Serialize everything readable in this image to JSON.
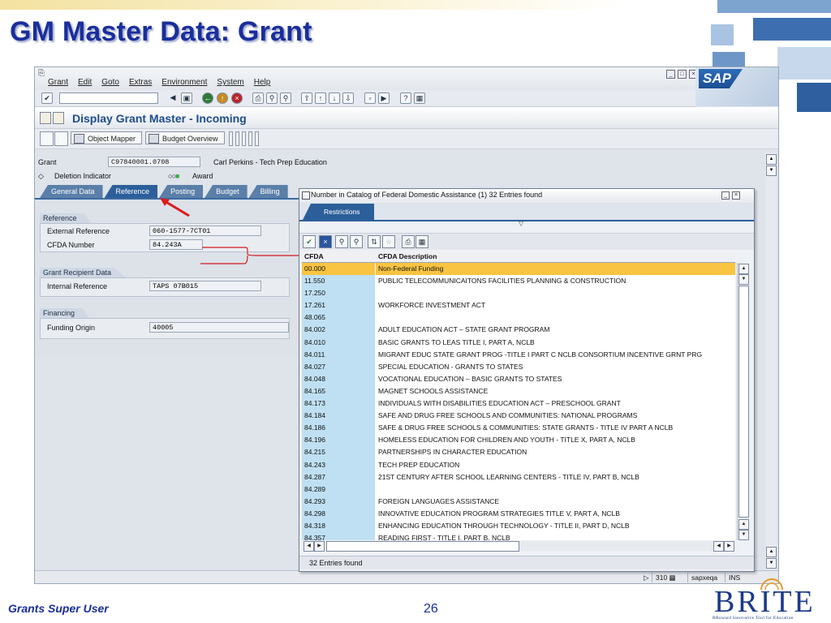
{
  "slide": {
    "title": "GM Master Data: Grant",
    "footer_left": "Grants Super User",
    "page_number": "26",
    "logo_word": "BRITE",
    "logo_tagline": "BRoward Innovative Tool for Education"
  },
  "sap": {
    "menu": [
      "Grant",
      "Edit",
      "Goto",
      "Extras",
      "Environment",
      "System",
      "Help"
    ],
    "logo_text": "SAP",
    "screen_title": "Display Grant Master - Incoming",
    "app_toolbar": {
      "object_mapper": "Object Mapper",
      "budget_overview": "Budget Overview"
    },
    "header": {
      "grant_label": "Grant",
      "grant_value": "C97840001.0708",
      "grant_desc": "Carl Perkins - Tech Prep Education",
      "deletion_label": "Deletion Indicator",
      "award_label": "Award"
    },
    "tabs": [
      "General Data",
      "Reference",
      "Posting",
      "Budget",
      "Billing"
    ],
    "active_tab": "Reference",
    "groups": {
      "reference": {
        "title": "Reference",
        "external_reference_label": "External Reference",
        "external_reference_value": "060-1577-7CT01",
        "cfda_label": "CFDA Number",
        "cfda_value": "84.243A"
      },
      "recipient": {
        "title": "Grant Recipient Data",
        "internal_reference_label": "Internal Reference",
        "internal_reference_value": "TAPS 07B015"
      },
      "financing": {
        "title": "Financing",
        "funding_origin_label": "Funding Origin",
        "funding_origin_value": "40005"
      }
    },
    "status": {
      "session": "310",
      "server": "sapxeqa",
      "mode": "INS"
    }
  },
  "popup": {
    "title": "Number in Catalog of Federal Domestic Assistance (1)   32 Entries found",
    "tab": "Restrictions",
    "columns": [
      "CFDA",
      "CFDA Description"
    ],
    "rows": [
      {
        "cfda": "00.000",
        "desc": "Non-Federal Funding",
        "selected": true
      },
      {
        "cfda": "11.550",
        "desc": "PUBLIC TELECOMMUNICAITONS FACILITIES PLANNING & CONSTRUCTION"
      },
      {
        "cfda": "17.250",
        "desc": ""
      },
      {
        "cfda": "17.261",
        "desc": "WORKFORCE INVESTMENT ACT"
      },
      {
        "cfda": "48.065",
        "desc": ""
      },
      {
        "cfda": "84.002",
        "desc": "ADULT EDUCATION ACT – STATE GRANT PROGRAM"
      },
      {
        "cfda": "84.010",
        "desc": "BASIC GRANTS TO LEAS TITLE I, PART A, NCLB"
      },
      {
        "cfda": "84.011",
        "desc": "MIGRANT EDUC STATE GRANT PROG -TITLE I PART C NCLB CONSORTIUM INCENTIVE GRNT PRG"
      },
      {
        "cfda": "84.027",
        "desc": "SPECIAL EDUCATION - GRANTS TO STATES"
      },
      {
        "cfda": "84.048",
        "desc": "VOCATIONAL EDUCATION – BASIC GRANTS TO STATES"
      },
      {
        "cfda": "84.165",
        "desc": "MAGNET SCHOOLS ASSISTANCE"
      },
      {
        "cfda": "84.173",
        "desc": "INDIVIDUALS WITH DISABILITIES EDUCATION ACT – PRESCHOOL GRANT"
      },
      {
        "cfda": "84.184",
        "desc": "SAFE AND DRUG FREE SCHOOLS AND COMMUNITIES: NATIONAL PROGRAMS"
      },
      {
        "cfda": "84.186",
        "desc": "SAFE & DRUG FREE SCHOOLS & COMMUNITIES: STATE GRANTS - TITLE IV PART A NCLB"
      },
      {
        "cfda": "84.196",
        "desc": "HOMELESS EDUCATION FOR CHILDREN AND YOUTH - TITLE X, PART A, NCLB"
      },
      {
        "cfda": "84.215",
        "desc": "PARTNERSHIPS IN CHARACTER EDUCATION"
      },
      {
        "cfda": "84.243",
        "desc": "TECH PREP EDUCATION"
      },
      {
        "cfda": "84.287",
        "desc": "21ST CENTURY AFTER SCHOOL LEARNING CENTERS - TITLE IV, PART B, NCLB"
      },
      {
        "cfda": "84.289",
        "desc": ""
      },
      {
        "cfda": "84.293",
        "desc": "FOREIGN LANGUAGES ASSISTANCE"
      },
      {
        "cfda": "84.298",
        "desc": "INNOVATIVE EDUCATION PROGRAM STRATEGIES TITLE V, PART A, NCLB"
      },
      {
        "cfda": "84.318",
        "desc": "ENHANCING EDUCATION THROUGH TECHNOLOGY - TITLE II, PART D, NCLB"
      },
      {
        "cfda": "84.357",
        "desc": "READING FIRST - TITLE I, PART B, NCLB"
      }
    ],
    "status": "32 Entries found"
  }
}
